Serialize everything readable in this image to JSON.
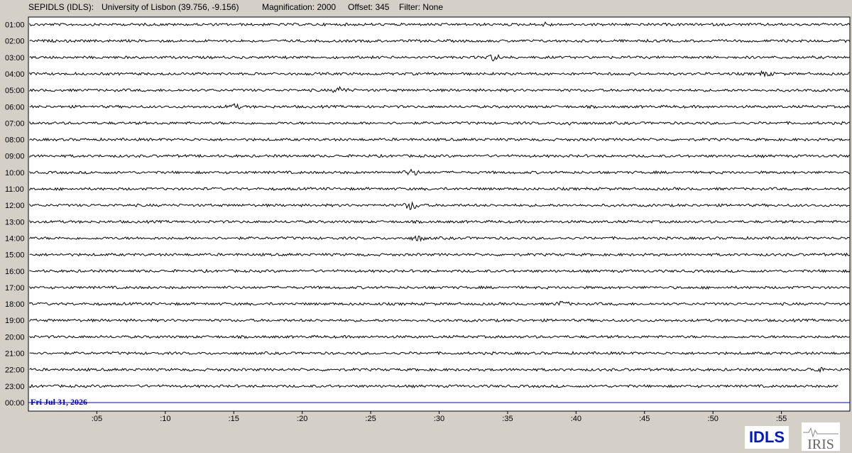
{
  "header": {
    "station": "SEPIDLS (IDLS):",
    "location": "University of Lisbon (39.756, -9.156)",
    "magnification": "Magnification: 2000",
    "offset": "Offset: 345",
    "filter": "Filter: None"
  },
  "logos": {
    "network": "IDLS",
    "org": "IRIS"
  },
  "chart_data": {
    "type": "line",
    "title": "",
    "date_label": "Fri Jul 31, 2026",
    "row_labels": [
      "01:00",
      "02:00",
      "03:00",
      "04:00",
      "05:00",
      "06:00",
      "07:00",
      "08:00",
      "09:00",
      "10:00",
      "11:00",
      "12:00",
      "13:00",
      "14:00",
      "15:00",
      "16:00",
      "17:00",
      "18:00",
      "19:00",
      "20:00",
      "21:00",
      "22:00",
      "23:00",
      "00:00"
    ],
    "x_tick_labels": [
      ":05",
      ":10",
      ":15",
      ":20",
      ":25",
      ":30",
      ":35",
      ":40",
      ":45",
      ":50",
      ":55"
    ],
    "x_ticks_minutes": [
      5,
      10,
      15,
      20,
      25,
      30,
      35,
      40,
      45,
      50,
      55
    ],
    "xlim_minutes": [
      0,
      60
    ],
    "trace_color": "#000000",
    "current_line_color": "#0000c0",
    "events": [
      {
        "row": "01:00",
        "minute": 37.8,
        "amplitude": 2
      },
      {
        "row": "03:00",
        "minute": 34.0,
        "amplitude": 4
      },
      {
        "row": "04:00",
        "minute": 53.8,
        "amplitude": 3
      },
      {
        "row": "05:00",
        "minute": 22.8,
        "amplitude": 4
      },
      {
        "row": "06:00",
        "minute": 15.0,
        "amplitude": 3
      },
      {
        "row": "07:00",
        "minute": 39.5,
        "amplitude": 2
      },
      {
        "row": "10:00",
        "minute": 28.0,
        "amplitude": 4
      },
      {
        "row": "12:00",
        "minute": 28.0,
        "amplitude": 6
      },
      {
        "row": "14:00",
        "minute": 28.5,
        "amplitude": 3
      },
      {
        "row": "18:00",
        "minute": 39.0,
        "amplitude": 3
      },
      {
        "row": "22:00",
        "minute": 57.5,
        "amplitude": 3
      }
    ],
    "last_trace_end_minute": 59.2
  }
}
